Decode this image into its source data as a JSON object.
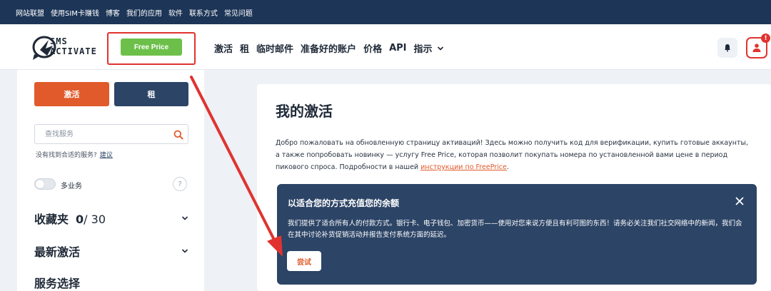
{
  "topbar": {
    "links": [
      "网站联盟",
      "使用SIM卡赚钱",
      "博客",
      "我们的应用",
      "软件",
      "联系方式",
      "常见问题"
    ]
  },
  "header": {
    "logo_line1": "SMS",
    "logo_line2": "ACTIVATE",
    "free_price_label": "Free Price",
    "nav": [
      "激活",
      "租",
      "临时邮件",
      "准备好的账户",
      "价格",
      "API",
      "指示"
    ],
    "user_badge": "!"
  },
  "sidebar": {
    "activate_label": "激活",
    "rent_label": "租",
    "search_placeholder": "查找服务",
    "not_found_text": "没有找到合适的服务?",
    "suggest_link": "建议",
    "multi_service_label": "多业务",
    "help_icon": "?",
    "favorites_title": "收藏夹",
    "favorites_count": "0",
    "favorites_max": "/ 30",
    "latest_title": "最新激活",
    "services_title": "服务选择"
  },
  "main": {
    "title": "我的激活",
    "intro_text": "Добро пожаловать на обновленную страницу активаций! Здесь можно получить код для верификации, купить готовые аккаунты, а также попробовать новинку — услугу Free Price, которая позволит покупать номера по установленной вами цене в период пикового спроса. Подробности в нашей ",
    "intro_link": "инструкции по FreePrice",
    "intro_end": ".",
    "promo": {
      "title": "以适合您的方式充值您的余额",
      "text": "我们提供了适合所有人的付款方式。银行卡、电子钱包、加密货币——使用对您来说方便且有利可图的东西！请务必关注我们社交网络中的新闻，我们会在其中讨论补货促销活动并报告支付系统方面的延迟。",
      "try_label": "尝试"
    }
  },
  "colors": {
    "topbar": "#1d3557",
    "accent_orange": "#e05a2b",
    "navy": "#2c4466",
    "green": "#6cc04a",
    "annotation_red": "#e0332f"
  },
  "icons": [
    "sms-activate-logo-icon",
    "bell-icon",
    "user-icon",
    "search-icon",
    "chevron-down-icon",
    "close-icon",
    "help-icon",
    "annotation-arrow-icon"
  ]
}
